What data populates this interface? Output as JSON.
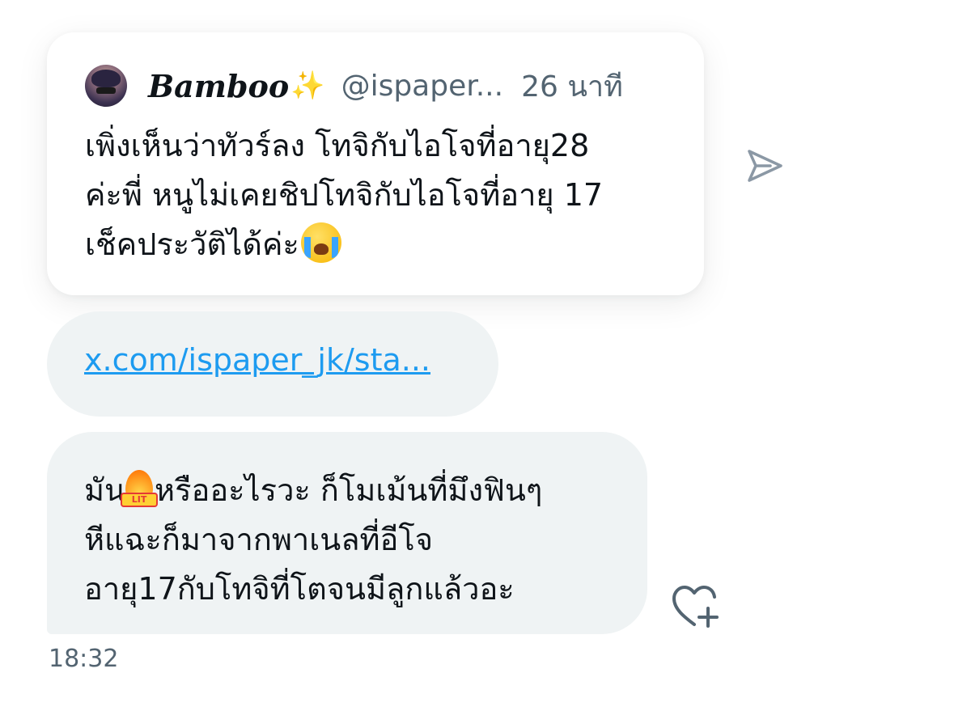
{
  "quoted_tweet": {
    "author_name": "Bamboo",
    "author_emoji": "✨",
    "handle": "@ispaper...",
    "time_ago": "26 นาที",
    "lines": [
      "เพิ่งเห็นว่าทัวร์ลง โทจิกับไอโจที่อายุ28",
      "ค่ะพี่ หนูไม่เคยชิปโทจิกับไอโจที่อายุ 17",
      "เช็คประวัติได้ค่ะ"
    ],
    "trailing_emoji": "loudly-crying-face"
  },
  "link": {
    "text": "x.com/ispaper_jk/sta..."
  },
  "message": {
    "line1_before_emoji": "มัน",
    "line1_emoji": "lit-fire",
    "line1_emoji_label": "LIT",
    "line1_after_emoji": "หรืออะไรวะ ก็โมเม้นที่มึงฟินๆ",
    "line2": "หีแฉะก็มาจากพาเนลที่อีโจ",
    "line3": "อายุ17กับโทจิที่โตจนมีลูกแล้วอะ"
  },
  "timestamp": "18:32",
  "icons": {
    "share": "send-icon",
    "react": "heart-plus-icon"
  },
  "colors": {
    "bubble_bg": "#eff3f4",
    "link": "#1d9bf0",
    "muted_text": "#536471",
    "icon": "#536471"
  }
}
